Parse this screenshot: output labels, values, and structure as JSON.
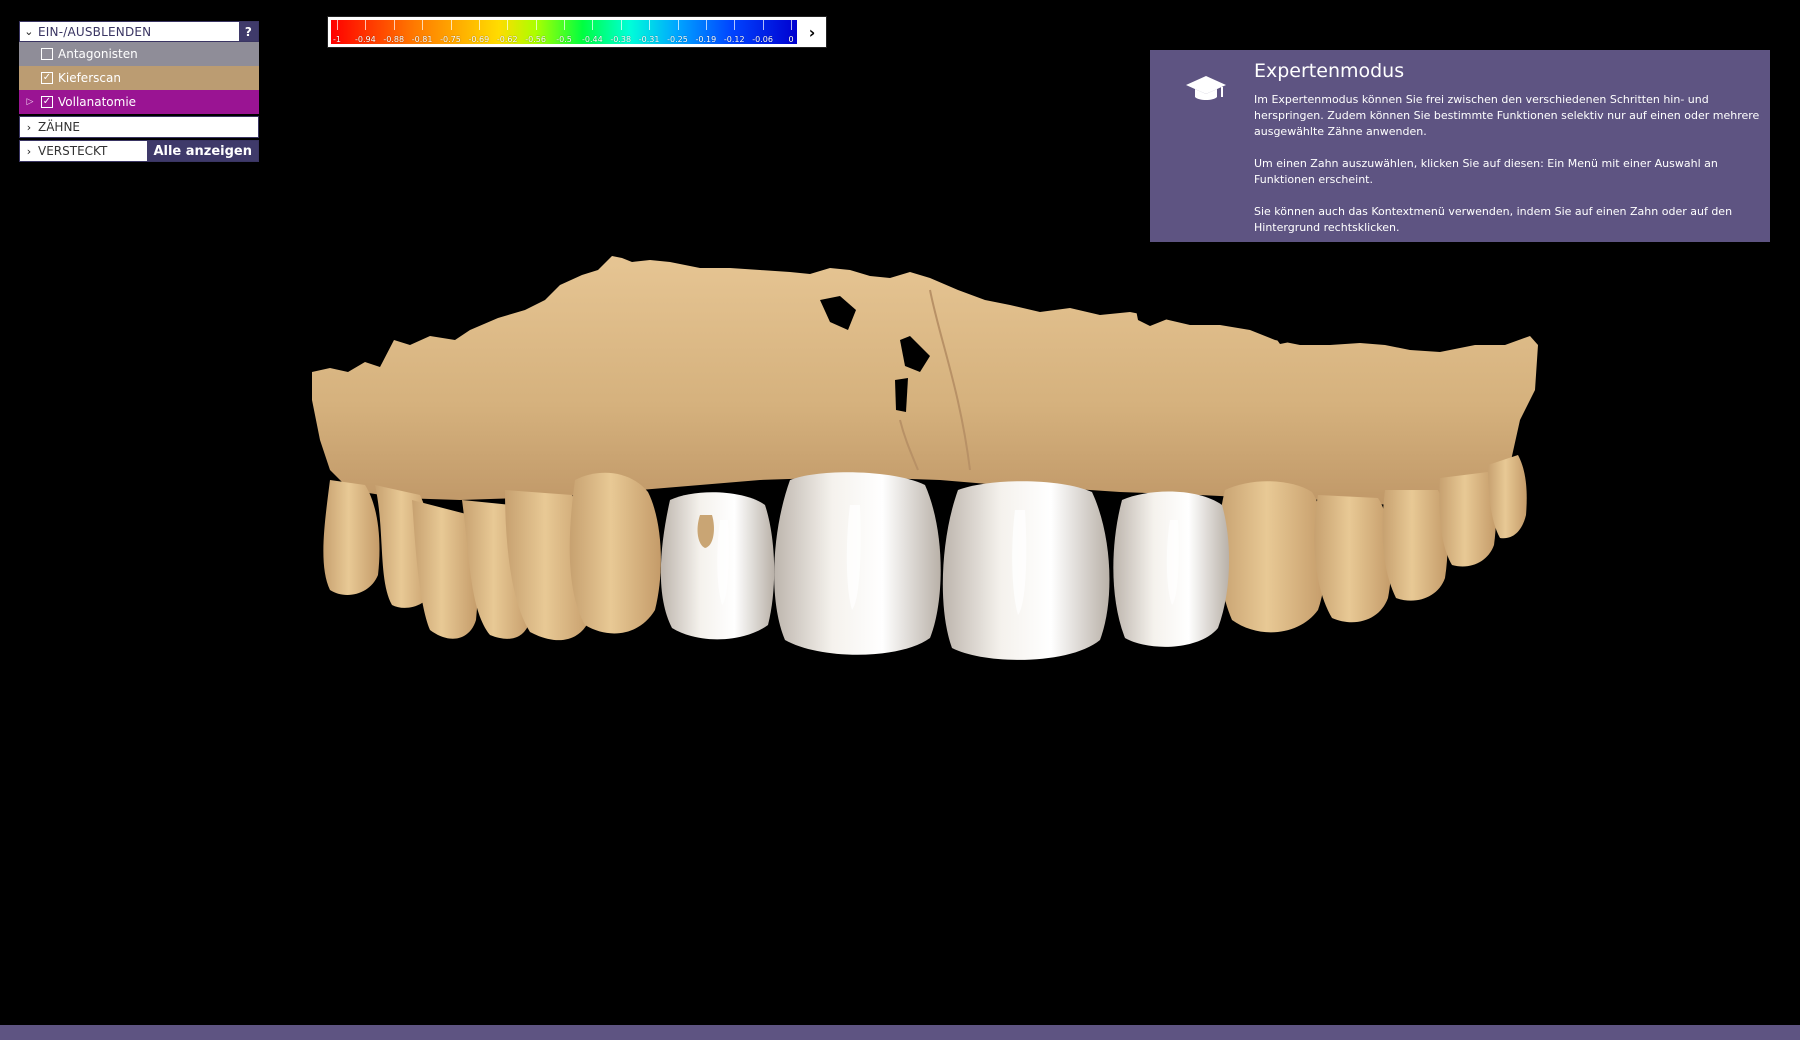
{
  "layers_panel": {
    "header_label": "EIN-/AUSBLENDEN",
    "help_label": "?",
    "items": [
      {
        "label": "Antagonisten",
        "checked": false,
        "color": "#8f8d98"
      },
      {
        "label": "Kieferscan",
        "checked": true,
        "color": "#bb9c72"
      },
      {
        "label": "Vollanatomie",
        "checked": true,
        "color": "#9a1493"
      }
    ],
    "teeth_section_label": "ZÄHNE",
    "hidden_section_label": "VERSTECKT",
    "show_all_label": "Alle anzeigen"
  },
  "color_scale": {
    "ticks": [
      "-1",
      "-0.94",
      "-0.88",
      "-0.81",
      "-0.75",
      "-0.69",
      "-0.62",
      "-0.56",
      "-0.5",
      "-0.44",
      "-0.38",
      "-0.31",
      "-0.25",
      "-0.19",
      "-0.12",
      "-0.06",
      "0"
    ],
    "next_icon": "chevron-right-icon"
  },
  "expert_mode": {
    "icon": "graduation-cap-icon",
    "title": "Expertenmodus",
    "paragraphs": [
      "Im Expertenmodus können Sie frei zwischen den verschiedenen Schritten hin- und herspringen. Zudem können Sie bestimmte Funktionen selektiv nur auf einen oder mehrere ausgewählte Zähne anwenden.",
      "Um einen Zahn auszuwählen, klicken Sie auf diesen: Ein Menü mit einer Auswahl an Funktionen erscheint.",
      "Sie können auch das Kontextmenü verwenden, indem Sie auf einen Zahn oder auf den Hintergrund rechtsklicken."
    ]
  },
  "colors": {
    "accent": "#5e5482",
    "jaw_scan": "#d9b886",
    "crown": "#ece8e2"
  }
}
